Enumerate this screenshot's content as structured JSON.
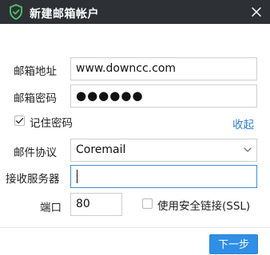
{
  "window": {
    "title": "新建邮箱帐户",
    "close_icon": "close-icon",
    "shield_icon": "shield-check-icon"
  },
  "form": {
    "email_label": "邮箱地址",
    "email_value": "www.downcc.com",
    "password_label": "邮箱密码",
    "password_value": "●●●●●●",
    "remember_label": "记住密码",
    "remember_checked": true,
    "collapse_link": "收起",
    "protocol_label": "邮件协议",
    "protocol_value": "Coremail",
    "server_label": "接收服务器",
    "server_value": "",
    "port_label": "端口",
    "port_value": "80",
    "ssl_label": "使用安全链接(SSL)",
    "ssl_checked": false
  },
  "footer": {
    "next_label": "下一步"
  },
  "colors": {
    "titlebar": "#2d3035",
    "accent": "#2f8ee6",
    "link": "#2e7fd1",
    "shield": "#4cc36a"
  }
}
